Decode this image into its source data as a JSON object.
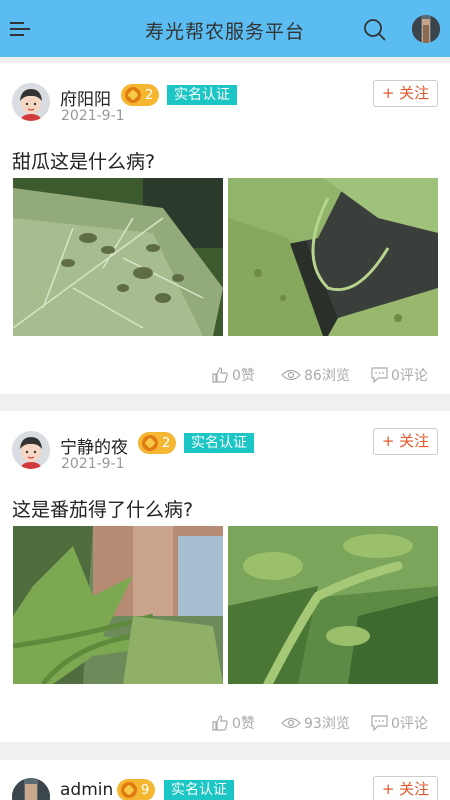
{
  "header": {
    "title": "寿光帮农服务平台"
  },
  "posts": [
    {
      "user": "府阳阳",
      "level": "2",
      "badge": "实名认证",
      "date": "2021-9-1",
      "follow": "+ 关注",
      "question": "甜瓜这是什么病?",
      "likes": "0赞",
      "views": "86浏览",
      "comments": "0评论"
    },
    {
      "user": "宁静的夜",
      "level": "2",
      "badge": "实名认证",
      "date": "2021-9-1",
      "follow": "+ 关注",
      "question": "这是番茄得了什么病?",
      "likes": "0赞",
      "views": "93浏览",
      "comments": "0评论"
    },
    {
      "user": "admin",
      "level": "9",
      "badge": "实名认证",
      "follow": "+ 关注"
    }
  ]
}
